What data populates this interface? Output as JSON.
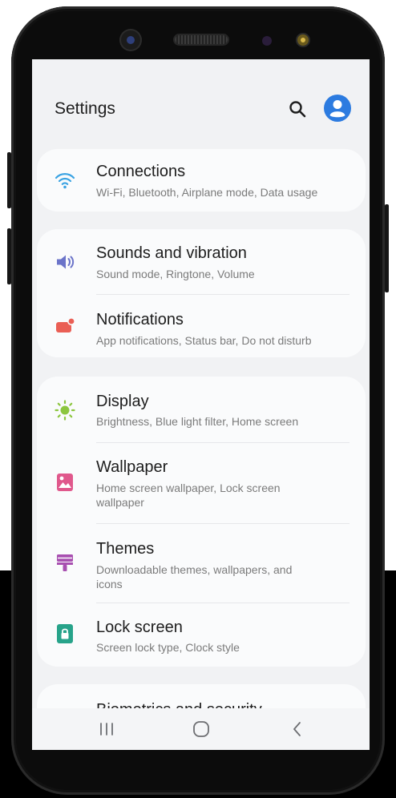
{
  "header": {
    "title": "Settings"
  },
  "icons": {
    "search": "search-icon",
    "account": "account-icon"
  },
  "colors": {
    "accent_blue": "#2c7be0",
    "connections": "#3aa3e3",
    "sounds": "#6b74c9",
    "notifications": "#ea5f55",
    "display": "#8cc63f",
    "wallpaper": "#e0588c",
    "themes": "#a84fb0",
    "lock": "#27a38a"
  },
  "groups": [
    {
      "items": [
        {
          "label": "Connections",
          "sub": "Wi-Fi, Bluetooth, Airplane mode, Data usage",
          "icon": "wifi-icon"
        }
      ]
    },
    {
      "items": [
        {
          "label": "Sounds and vibration",
          "sub": "Sound mode, Ringtone, Volume",
          "icon": "volume-icon"
        },
        {
          "label": "Notifications",
          "sub": "App notifications, Status bar, Do not disturb",
          "icon": "notification-icon"
        }
      ]
    },
    {
      "items": [
        {
          "label": "Display",
          "sub": "Brightness, Blue light filter, Home screen",
          "icon": "brightness-icon"
        },
        {
          "label": "Wallpaper",
          "sub": "Home screen wallpaper, Lock screen wallpaper",
          "icon": "wallpaper-icon"
        },
        {
          "label": "Themes",
          "sub": "Downloadable themes, wallpapers, and icons",
          "icon": "themes-icon"
        },
        {
          "label": "Lock screen",
          "sub": "Screen lock type, Clock style",
          "icon": "lock-icon"
        }
      ]
    },
    {
      "items": [
        {
          "label": "Biometrics and security",
          "icon": "biometrics-icon"
        }
      ]
    }
  ],
  "navbar": {
    "recents": "recents-icon",
    "home": "home-icon",
    "back": "back-icon"
  }
}
